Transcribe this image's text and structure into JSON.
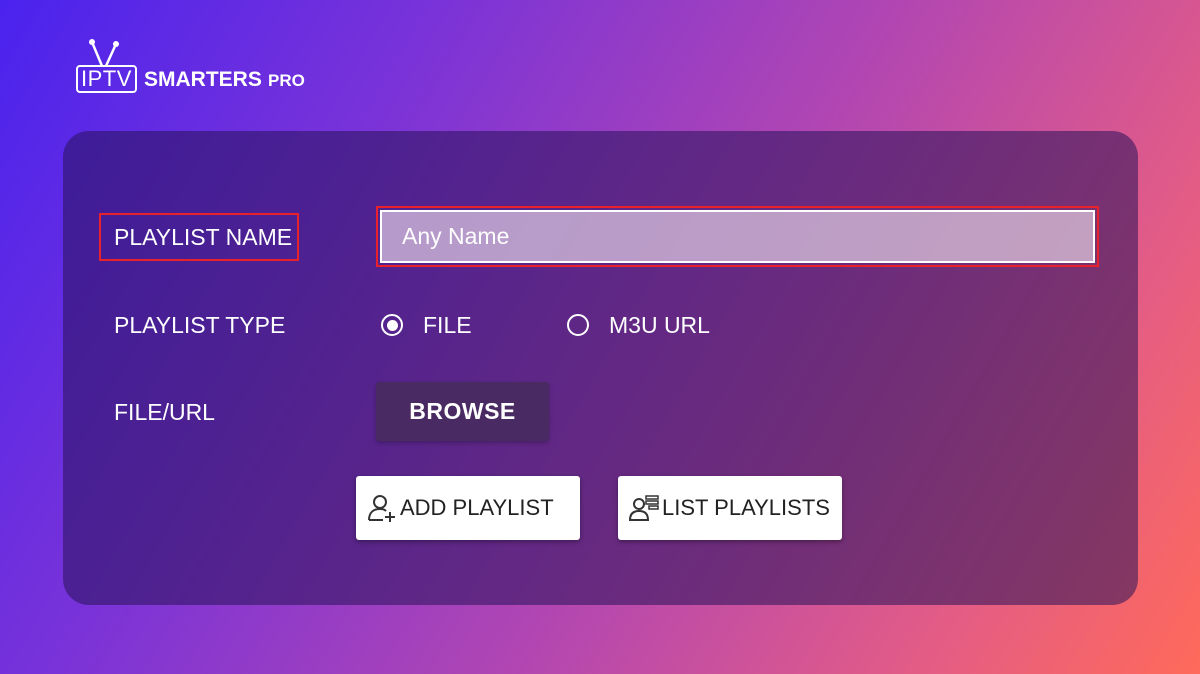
{
  "logo": {
    "iptv": "IPTV",
    "smarters": "SMARTERS",
    "pro": "PRO"
  },
  "form": {
    "playlist_name_label": "PLAYLIST NAME",
    "playlist_name_placeholder": "Any Name",
    "playlist_type_label": "PLAYLIST TYPE",
    "type_options": [
      {
        "label": "FILE",
        "selected": true
      },
      {
        "label": "M3U URL",
        "selected": false
      }
    ],
    "file_url_label": "FILE/URL",
    "browse_label": "BROWSE"
  },
  "actions": {
    "add_playlist_label": "ADD PLAYLIST",
    "add_playlist_icon": "user-plus-icon",
    "list_playlists_label": "LIST PLAYLISTS",
    "list_playlists_icon": "user-list-icon"
  },
  "colors": {
    "highlight_border": "#e8212a",
    "panel_bg": "rgba(40,18,90,0.55)",
    "browse_bg": "#4a2a63",
    "gradient_start": "#4a23ee",
    "gradient_end": "#ff6a5a"
  }
}
